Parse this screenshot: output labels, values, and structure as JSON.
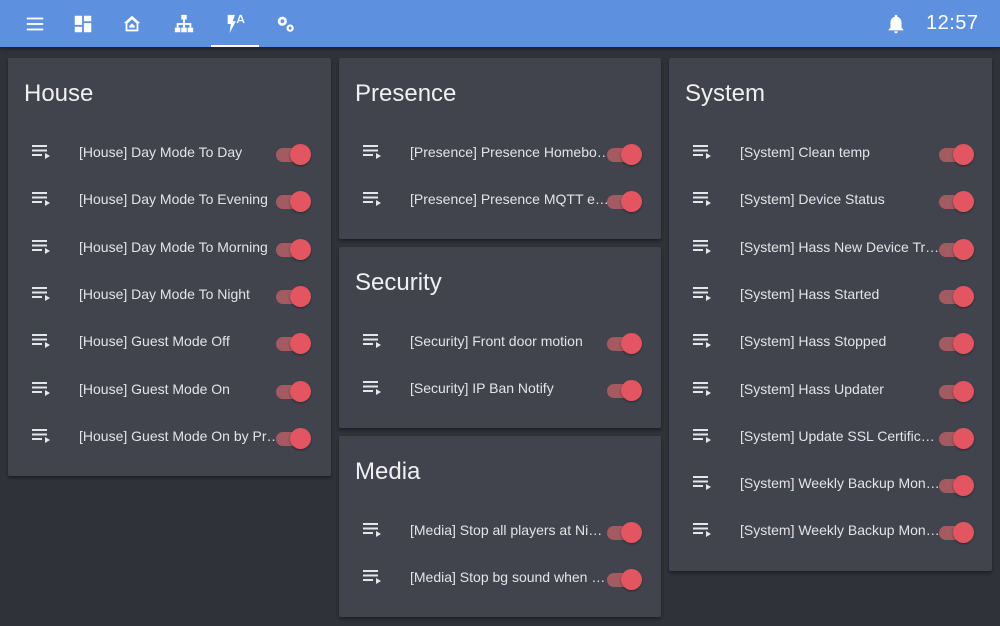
{
  "clock": "12:57",
  "nav": {
    "icons": [
      "menu-icon",
      "dashboard-icon",
      "home-icon",
      "network-icon",
      "automation-icon",
      "settings-icon",
      "bell-icon"
    ],
    "active": "automation-icon"
  },
  "colors": {
    "topbar": "#5d90de",
    "background": "#303239",
    "card": "#42444d",
    "toggle_on": "#e35560"
  },
  "cards": {
    "house": {
      "title": "House",
      "items": [
        {
          "label": "[House] Day Mode To Day",
          "enabled": true
        },
        {
          "label": "[House] Day Mode To Evening",
          "enabled": true
        },
        {
          "label": "[House] Day Mode To Morning",
          "enabled": true
        },
        {
          "label": "[House] Day Mode To Night",
          "enabled": true
        },
        {
          "label": "[House] Guest Mode Off",
          "enabled": true
        },
        {
          "label": "[House] Guest Mode On",
          "enabled": true
        },
        {
          "label": "[House] Guest Mode On by Pr…",
          "enabled": true
        }
      ]
    },
    "presence": {
      "title": "Presence",
      "items": [
        {
          "label": "[Presence] Presence Homebo…",
          "enabled": true
        },
        {
          "label": "[Presence] Presence MQTT e…",
          "enabled": true
        }
      ]
    },
    "security": {
      "title": "Security",
      "items": [
        {
          "label": "[Security] Front door motion",
          "enabled": true
        },
        {
          "label": "[Security] IP Ban Notify",
          "enabled": true
        }
      ]
    },
    "media": {
      "title": "Media",
      "items": [
        {
          "label": "[Media] Stop all players at Ni…",
          "enabled": true
        },
        {
          "label": "[Media] Stop bg sound when …",
          "enabled": true
        }
      ]
    },
    "system": {
      "title": "System",
      "items": [
        {
          "label": "[System] Clean temp",
          "enabled": true
        },
        {
          "label": "[System] Device Status",
          "enabled": true
        },
        {
          "label": "[System] Hass New Device Tr…",
          "enabled": true
        },
        {
          "label": "[System] Hass Started",
          "enabled": true
        },
        {
          "label": "[System] Hass Stopped",
          "enabled": true
        },
        {
          "label": "[System] Hass Updater",
          "enabled": true
        },
        {
          "label": "[System] Update SSL Certific…",
          "enabled": true
        },
        {
          "label": "[System] Weekly Backup Mon…",
          "enabled": true
        },
        {
          "label": "[System] Weekly Backup Mon…",
          "enabled": true
        }
      ]
    }
  }
}
